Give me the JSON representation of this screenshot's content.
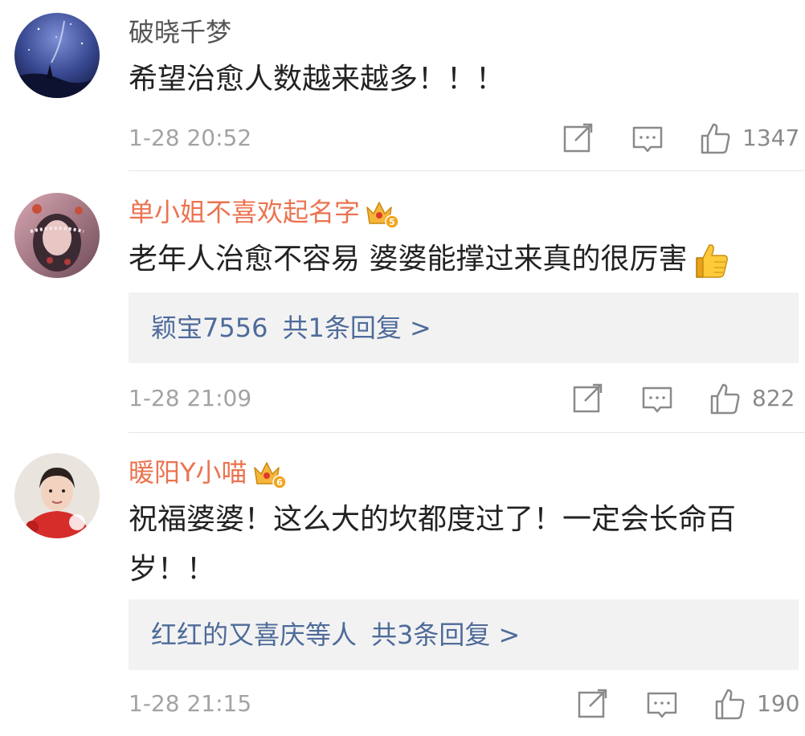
{
  "comments": [
    {
      "username": "破晓千梦",
      "content_lines": [
        "希望治愈人数越来越多！！！"
      ],
      "timestamp": "1-28 20:52",
      "likes": "1347",
      "avatar": "starry-night-avatar",
      "vip": false
    },
    {
      "username": "单小姐不喜欢起名字",
      "content_lines": [
        "老年人治愈不容易 婆婆能撑过来真的很厉害"
      ],
      "emoji": "thumbs-up-emoji",
      "reply": {
        "who": "颖宝7556",
        "summary": "共1条回复 >"
      },
      "timestamp": "1-28 21:09",
      "likes": "822",
      "avatar": "floral-portrait-avatar",
      "vip": true
    },
    {
      "username": "暖阳Y小喵",
      "content_lines": [
        "祝福婆婆！这么大的坎都度过了！一定会长命百",
        "岁！！"
      ],
      "reply": {
        "who": "红红的又喜庆等人",
        "summary": "共3条回复 >"
      },
      "timestamp": "1-28 21:15",
      "likes": "190",
      "avatar": "person-red-sweater-avatar",
      "vip": true
    }
  ],
  "colors": {
    "vip_name": "#eb7350",
    "normal_name": "#555555",
    "reply_link": "#4e6b9a",
    "meta": "#a3a3a3"
  }
}
